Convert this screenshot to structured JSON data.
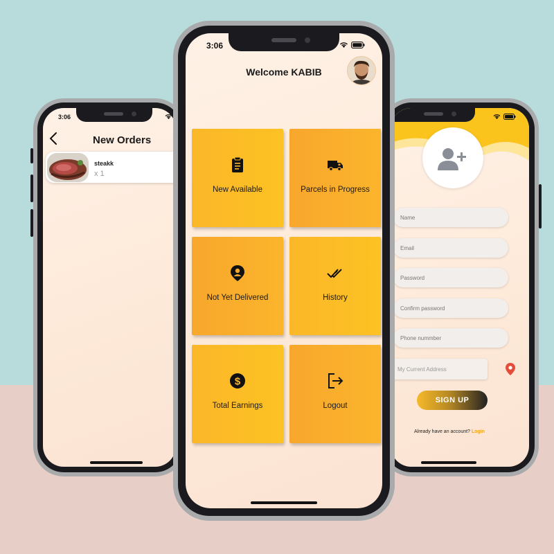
{
  "status_time": "3:06",
  "orders_screen": {
    "title": "New Orders",
    "order": {
      "name": "steakk",
      "quantity": "x 1"
    }
  },
  "home_screen": {
    "welcome": "Welcome KABIB",
    "tiles": [
      {
        "label": "New Available",
        "icon": "clipboard-icon"
      },
      {
        "label": "Parcels in Progress",
        "icon": "truck-icon"
      },
      {
        "label": "Not Yet Delivered",
        "icon": "location-pin-icon"
      },
      {
        "label": "History",
        "icon": "double-check-icon"
      },
      {
        "label": "Total Earnings",
        "icon": "dollar-icon"
      },
      {
        "label": "Logout",
        "icon": "logout-icon"
      }
    ]
  },
  "signup_screen": {
    "fields": {
      "name": "Name",
      "email": "Email",
      "password": "Password",
      "confirm_password": "Confirm password",
      "phone": "Phone nummber",
      "address": "My Current Address"
    },
    "signup_label": "SIGN UP",
    "have_account": "Already have an account?",
    "login_label": "Login"
  },
  "colors": {
    "accent": "#FBB729",
    "tile_alt": "#F8A72D",
    "login_link": "#F2A417",
    "pin": "#E44D3A"
  }
}
